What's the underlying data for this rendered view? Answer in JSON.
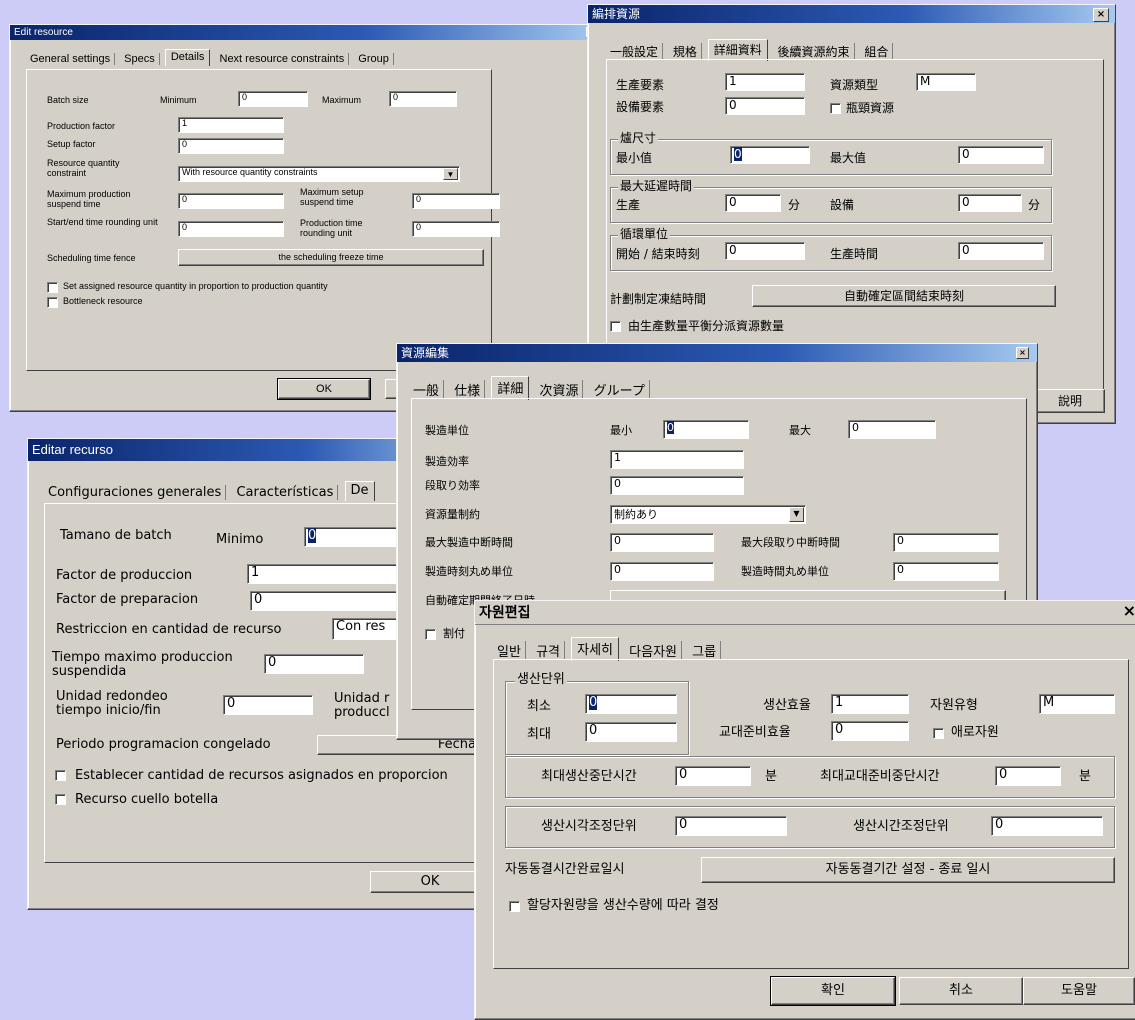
{
  "en": {
    "title": "Edit resource",
    "tabs": [
      "General settings",
      "Specs",
      "Details",
      "Next resource constraints",
      "Group"
    ],
    "batch_size": "Batch size",
    "minimum": "Minimum",
    "maximum": "Maximum",
    "min_val": "0",
    "max_val": "0",
    "production_factor": "Production factor",
    "production_factor_val": "1",
    "setup_factor": "Setup factor",
    "setup_factor_val": "0",
    "rq_constraint": "Resource quantity constraint",
    "rq_constraint_val": "With resource quantity constraints",
    "max_prod_suspend": "Maximum production suspend time",
    "max_prod_suspend_val": "0",
    "max_setup_suspend": "Maximum setup suspend time",
    "max_setup_suspend_val": "0",
    "start_end_rounding": "Start/end time rounding unit",
    "start_end_rounding_val": "0",
    "prod_time_rounding": "Production time rounding unit",
    "prod_time_rounding_val": "0",
    "fence": "Scheduling time fence",
    "fence_button": "the scheduling freeze time",
    "set_assigned": "Set assigned resource quantity in proportion to production quantity",
    "bottleneck": "Bottleneck resource",
    "ok": "OK"
  },
  "zh": {
    "title": "編排資源",
    "tabs": [
      "一般設定",
      "規格",
      "詳細資料",
      "後續資源約束",
      "組合"
    ],
    "prod_factor": "生產要素",
    "prod_factor_val": "1",
    "resource_type": "資源類型",
    "resource_type_val": "M",
    "equip_factor": "設備要素",
    "equip_factor_val": "0",
    "neck_resource": "瓶頸資源",
    "furnace_size": "爐尺寸",
    "min": "最小值",
    "min_val": "0",
    "max": "最大值",
    "max_val": "0",
    "max_delay": "最大延遲時間",
    "production": "生產",
    "production_val": "0",
    "minute": "分",
    "equipment": "設備",
    "equipment_val": "0",
    "cycle_unit": "循環單位",
    "start_end": "開始 / 結束時刻",
    "start_end_val": "0",
    "prod_time": "生產時間",
    "prod_time_val": "0",
    "plan_freeze": "計劃制定凍結時間",
    "freeze_button": "自動確定區間結束時刻",
    "balance": "由生產數量平衡分派資源數量",
    "help": "說明"
  },
  "es": {
    "title": "Editar recurso",
    "tabs": [
      "Configuraciones generales",
      "Características",
      "De"
    ],
    "batch_size": "Tamano de batch",
    "minimo": "Minimo",
    "minimo_val": "0",
    "prod_factor": "Factor de produccion",
    "prod_factor_val": "1",
    "prep_factor": "Factor de preparacion",
    "prep_factor_val": "0",
    "restriction": "Restriccion en cantidad de recurso",
    "restriction_val": "Con res",
    "max_suspend": "Tiempo maximo produccion suspendida",
    "max_suspend_val": "0",
    "rounding": "Unidad redondeo tiempo inicio/fin",
    "rounding_val": "0",
    "rounding2": "Unidad r produccl",
    "frozen": "Periodo  programacion congelado",
    "frozen_button": "Fecha",
    "establish": "Establecer cantidad de recursos asignados en proporcion",
    "bottleneck": "Recurso cuello botella",
    "ok": "OK"
  },
  "ja": {
    "title": "資源編集",
    "tabs": [
      "一般",
      "仕様",
      "詳細",
      "次資源",
      "グループ"
    ],
    "prod_unit": "製造単位",
    "min": "最小",
    "min_val": "0",
    "max": "最大",
    "max_val": "0",
    "prod_eff": "製造効率",
    "prod_eff_val": "1",
    "setup_eff": "段取り効率",
    "setup_eff_val": "0",
    "resource_constraint": "資源量制約",
    "resource_constraint_val": "制約あり",
    "max_prod_interrupt": "最大製造中断時間",
    "max_prod_interrupt_val": "0",
    "max_setup_interrupt": "最大段取り中断時間",
    "max_setup_interrupt_val": "0",
    "prod_time_round": "製造時刻丸め単位",
    "prod_time_round_val": "0",
    "prod_dur_round": "製造時間丸め単位",
    "prod_dur_round_val": "0",
    "auto_confirm": "自動確定期間終了日時",
    "assign_prefix": "割付"
  },
  "ko": {
    "title": "자원편집",
    "tabs": [
      "일반",
      "규격",
      "자세히",
      "다음자원",
      "그룹"
    ],
    "prod_unit": "생산단위",
    "min": "최소",
    "min_val": "0",
    "max": "최대",
    "max_val": "0",
    "prod_eff": "생산효율",
    "prod_eff_val": "1",
    "shift_eff": "교대준비효율",
    "shift_eff_val": "0",
    "resource_type": "자원유형",
    "resource_type_val": "M",
    "bottleneck": "애로자원",
    "max_prod_stop": "최대생산중단시간",
    "max_prod_stop_val": "0",
    "minute": "분",
    "max_shift_stop": "최대교대준비중단시간",
    "max_shift_stop_val": "0",
    "time_adjust": "생산시각조정단위",
    "time_adjust_val": "0",
    "dur_adjust": "생산시간조정단위",
    "dur_adjust_val": "0",
    "auto_freeze": "자동동결시간완료일시",
    "freeze_button": "자동동결기간 설정 - 종료 일시",
    "assign": "할당자원량을 생산수량에 따라 결정",
    "ok": "확인",
    "cancel": "취소",
    "help": "도움말"
  }
}
